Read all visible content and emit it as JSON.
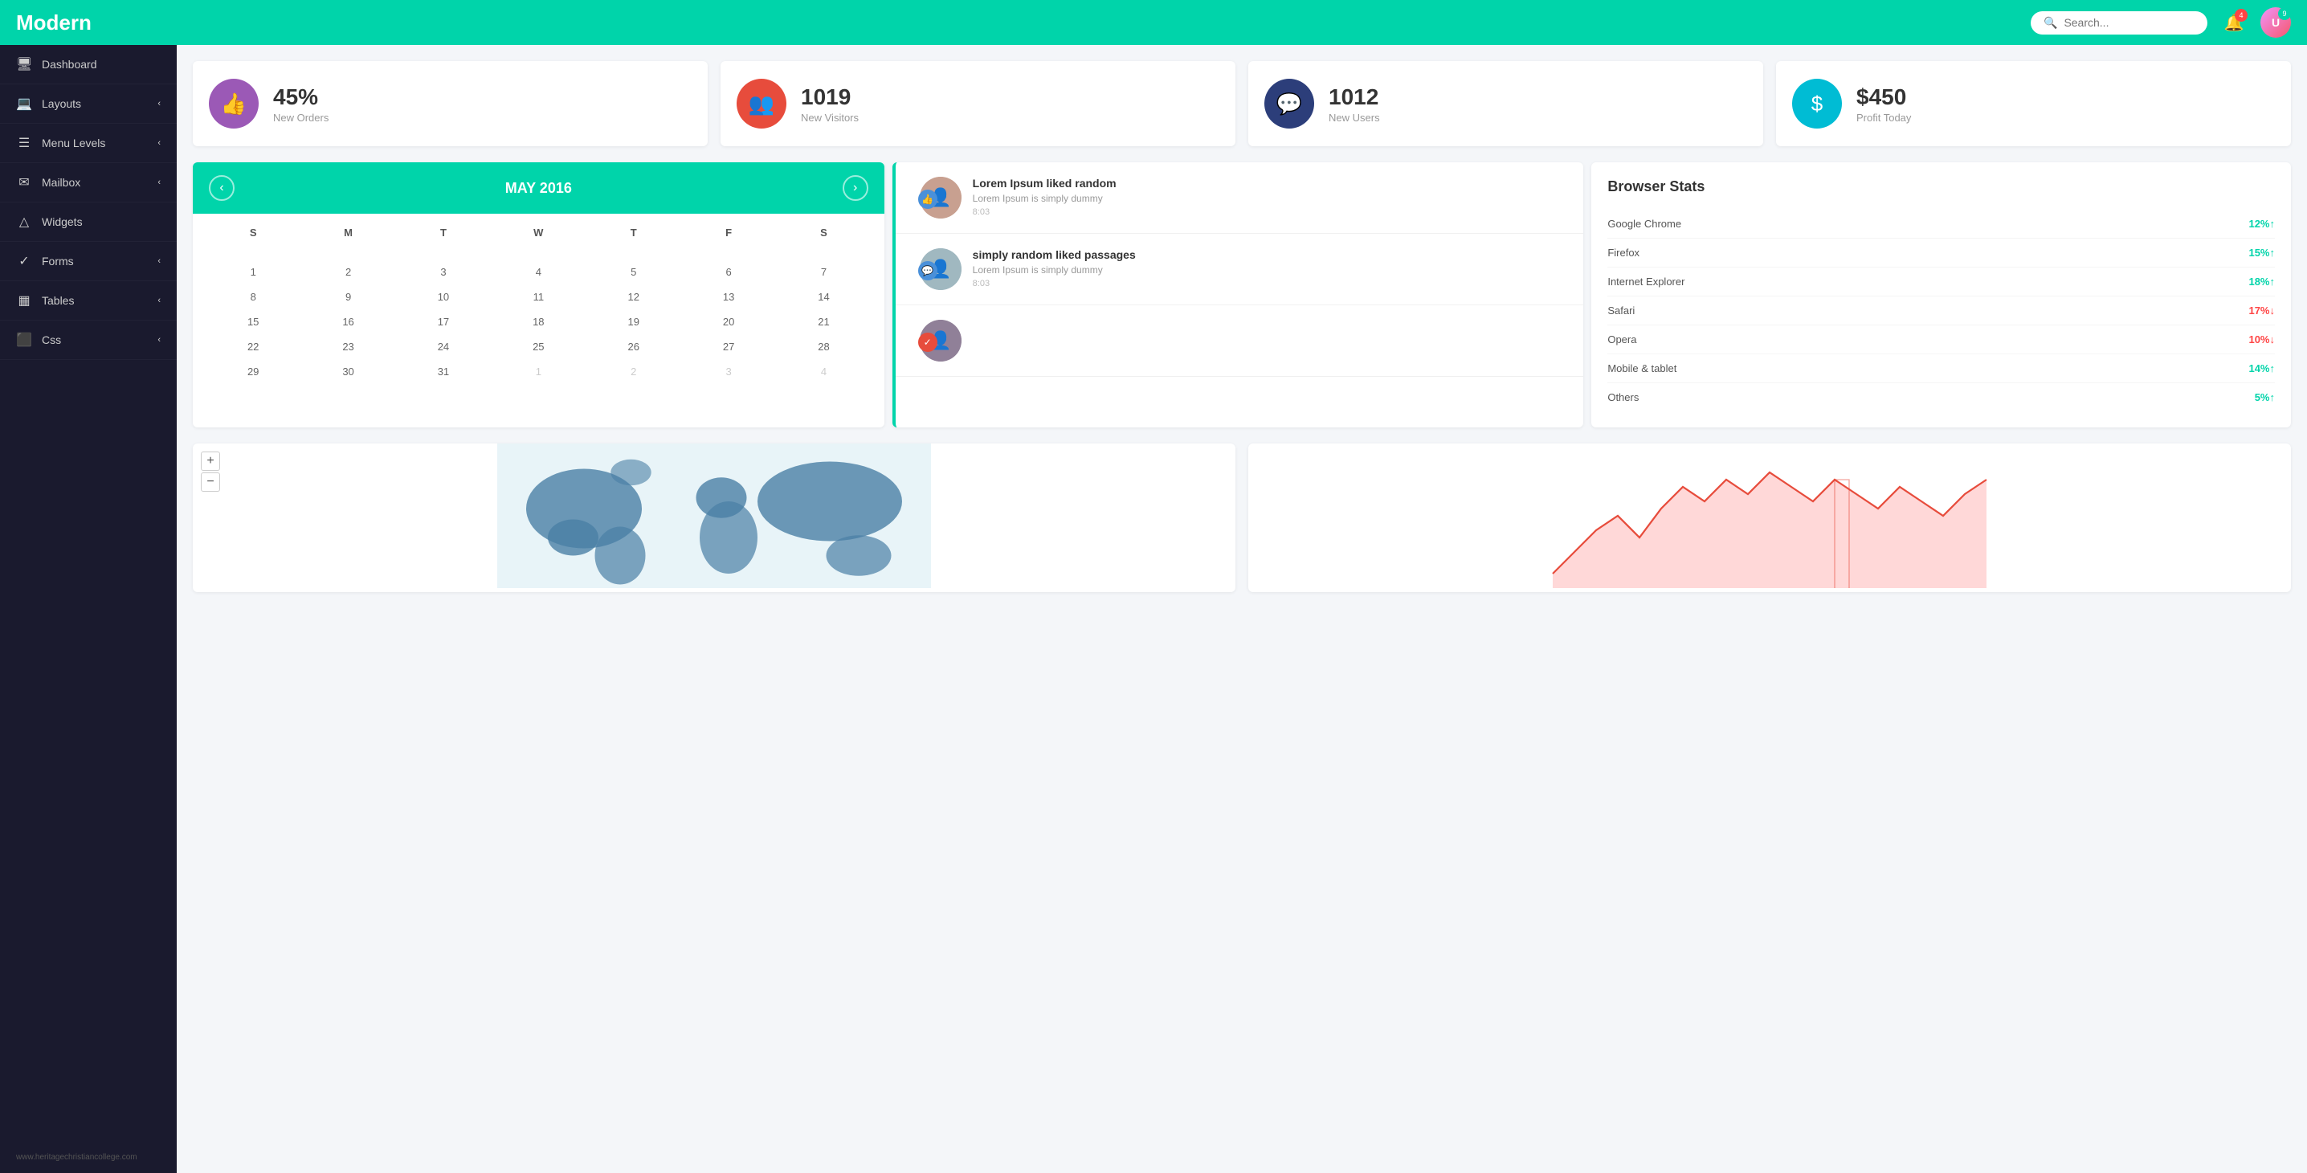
{
  "header": {
    "title": "Modern",
    "search_placeholder": "Search...",
    "notif_count": "4",
    "avatar_badge": "9"
  },
  "sidebar": {
    "items": [
      {
        "id": "dashboard",
        "icon": "🖥",
        "label": "Dashboard",
        "arrow": false
      },
      {
        "id": "layouts",
        "icon": "💻",
        "label": "Layouts",
        "arrow": true
      },
      {
        "id": "menu-levels",
        "icon": "☰",
        "label": "Menu Levels",
        "arrow": true
      },
      {
        "id": "mailbox",
        "icon": "✉",
        "label": "Mailbox",
        "arrow": true
      },
      {
        "id": "widgets",
        "icon": "△",
        "label": "Widgets",
        "arrow": false
      },
      {
        "id": "forms",
        "icon": "✓",
        "label": "Forms",
        "arrow": true
      },
      {
        "id": "tables",
        "icon": "▦",
        "label": "Tables",
        "arrow": true
      },
      {
        "id": "css",
        "icon": "⬛",
        "label": "Css",
        "arrow": true
      }
    ],
    "footer": "www.heritagechristiancollege.com"
  },
  "stats": [
    {
      "id": "orders",
      "icon": "👍",
      "bg": "#9b59b6",
      "value": "45%",
      "label": "New Orders"
    },
    {
      "id": "visitors",
      "icon": "👥",
      "bg": "#e74c3c",
      "value": "1019",
      "label": "New Visitors"
    },
    {
      "id": "users",
      "icon": "💬",
      "bg": "#2c3e7a",
      "value": "1012",
      "label": "New Users"
    },
    {
      "id": "profit",
      "icon": "$",
      "bg": "#00bcd4",
      "value": "$450",
      "label": "Profit Today"
    }
  ],
  "calendar": {
    "prev_label": "‹",
    "next_label": "›",
    "month_year": "MAY 2016",
    "day_headers": [
      "S",
      "M",
      "T",
      "W",
      "T",
      "F",
      "S"
    ],
    "weeks": [
      [
        "",
        "",
        "",
        "",
        "",
        "",
        ""
      ],
      [
        "1",
        "2",
        "3",
        "4",
        "5",
        "6",
        "7"
      ],
      [
        "8",
        "9",
        "10",
        "11",
        "12",
        "13",
        "14"
      ],
      [
        "15",
        "16",
        "17",
        "18",
        "19",
        "20",
        "21"
      ],
      [
        "22",
        "23",
        "24",
        "25",
        "26",
        "27",
        "28"
      ],
      [
        "29",
        "30",
        "31",
        "1",
        "2",
        "3",
        "4"
      ]
    ],
    "today": "29"
  },
  "feed": {
    "items": [
      {
        "icon": "👍",
        "icon_color": "#4a90d9",
        "title": "Lorem Ipsum liked random",
        "body": "Lorem Ipsum is simply dummy",
        "time": "8:03"
      },
      {
        "icon": "💬",
        "icon_color": "#4a90d9",
        "title": "simply random liked passages",
        "body": "Lorem Ipsum is simply dummy",
        "time": "8:03"
      },
      {
        "icon": "✓",
        "icon_color": "#e74c3c",
        "title": "",
        "body": "",
        "time": ""
      }
    ]
  },
  "browser_stats": {
    "title": "Browser Stats",
    "items": [
      {
        "name": "Google Chrome",
        "value": "12%",
        "trend": "up"
      },
      {
        "name": "Firefox",
        "value": "15%",
        "trend": "up"
      },
      {
        "name": "Internet Explorer",
        "value": "18%",
        "trend": "up"
      },
      {
        "name": "Safari",
        "value": "17%",
        "trend": "down"
      },
      {
        "name": "Opera",
        "value": "10%",
        "trend": "down"
      },
      {
        "name": "Mobile & tablet",
        "value": "14%",
        "trend": "up"
      },
      {
        "name": "Others",
        "value": "5%",
        "trend": "up"
      }
    ]
  }
}
